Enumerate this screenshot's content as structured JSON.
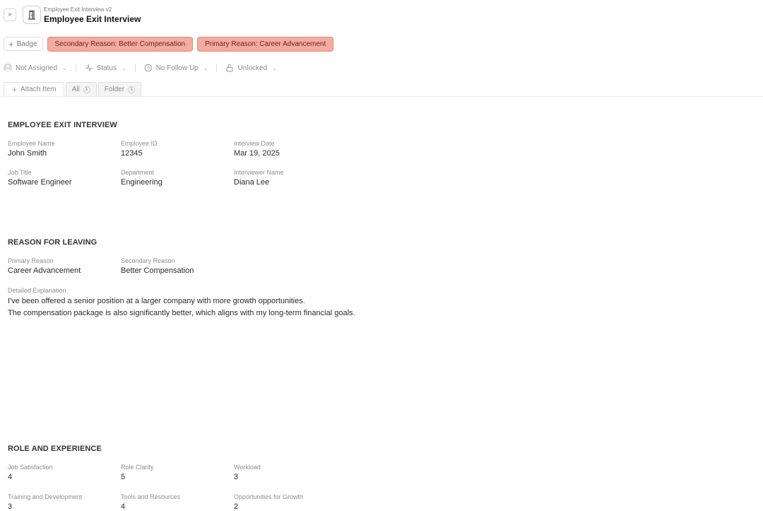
{
  "header": {
    "subtitle": "Employee Exit Interview v2",
    "title": "Employee Exit Interview",
    "toggle_glyph": "»",
    "doc_icon": "door-icon"
  },
  "badges": {
    "add_label": "Badge",
    "items": [
      {
        "label": "Secondary Reason: Better Compensation",
        "color": "#f5ab9f"
      },
      {
        "label": "Primary Reason: Career Advancement",
        "color": "#f5ab9f"
      }
    ]
  },
  "meta": {
    "assignee": "Not Assigned",
    "status": "Status",
    "follow_up": "No Follow Up",
    "lock": "Unlocked"
  },
  "tabs": {
    "attach_label": "Attach Item",
    "items": [
      {
        "label": "All",
        "count": "1"
      },
      {
        "label": "Folder",
        "count": "1"
      }
    ]
  },
  "sections": {
    "employee": {
      "title": "EMPLOYEE EXIT INTERVIEW",
      "fields": [
        {
          "label": "Employee Name",
          "value": "John Smith"
        },
        {
          "label": "Employee ID",
          "value": "12345"
        },
        {
          "label": "Interview Date",
          "value": "Mar 19, 2025"
        },
        {
          "label": "Job Title",
          "value": "Software Engineer"
        },
        {
          "label": "Department",
          "value": "Engineering"
        },
        {
          "label": "Interviewer Name",
          "value": "Diana Lee"
        }
      ]
    },
    "reason": {
      "title": "REASON FOR LEAVING",
      "fields": [
        {
          "label": "Primary Reason",
          "value": "Career Advancement"
        },
        {
          "label": "Secondary Reason",
          "value": "Better Compensation"
        }
      ],
      "explanation_label": "Detailed Explanation",
      "explanation_lines": [
        "I've been offered a senior position at a larger company with more growth opportunities.",
        "The compensation package is also significantly better, which aligns with my long-term financial goals."
      ]
    },
    "role": {
      "title": "ROLE AND EXPERIENCE",
      "fields": [
        {
          "label": "Job Satisfaction",
          "value": "4"
        },
        {
          "label": "Role Clarity",
          "value": "5"
        },
        {
          "label": "Workload",
          "value": "3"
        },
        {
          "label": "Training and Development",
          "value": "3"
        },
        {
          "label": "Tools and Resources",
          "value": "4"
        },
        {
          "label": "Opportunities for Growth",
          "value": "2"
        }
      ]
    }
  }
}
